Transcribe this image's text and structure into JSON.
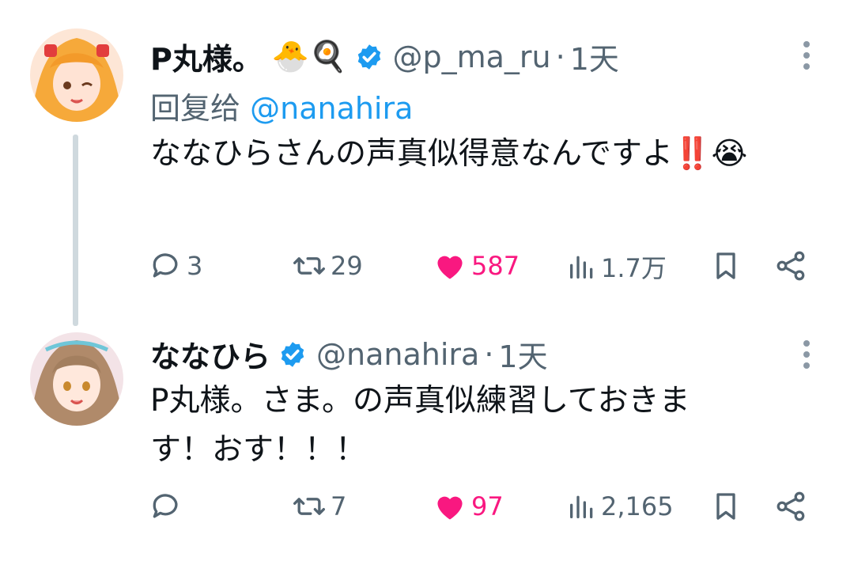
{
  "tweets": [
    {
      "name": "P丸様。",
      "name_emojis": "🐣🍳",
      "handle": "@p_ma_ru",
      "dot": "·",
      "time": "1天",
      "reply_prefix": "回复给",
      "reply_mention": "@nanahira",
      "text": "ななひらさんの声真似得意なんですよ‼️😭",
      "replies": "3",
      "retweets": "29",
      "likes": "587",
      "views": "1.7万"
    },
    {
      "name": "ななひら",
      "handle": "@nanahira",
      "dot": "·",
      "time": "1天",
      "text_line1": "P丸様。さま。の声真似練習しておきま",
      "text_line2": "す！おす！！！",
      "replies": "",
      "retweets": "7",
      "likes": "97",
      "views": "2,165"
    }
  ],
  "colors": {
    "like": "#f91880",
    "verified": "#1d9bf0",
    "muted": "#536471",
    "thread_line": "#cfd9de"
  },
  "icons": [
    "reply-icon",
    "retweet-icon",
    "heart-icon",
    "views-icon",
    "bookmark-icon",
    "share-icon",
    "verified-badge-icon",
    "more-icon"
  ]
}
